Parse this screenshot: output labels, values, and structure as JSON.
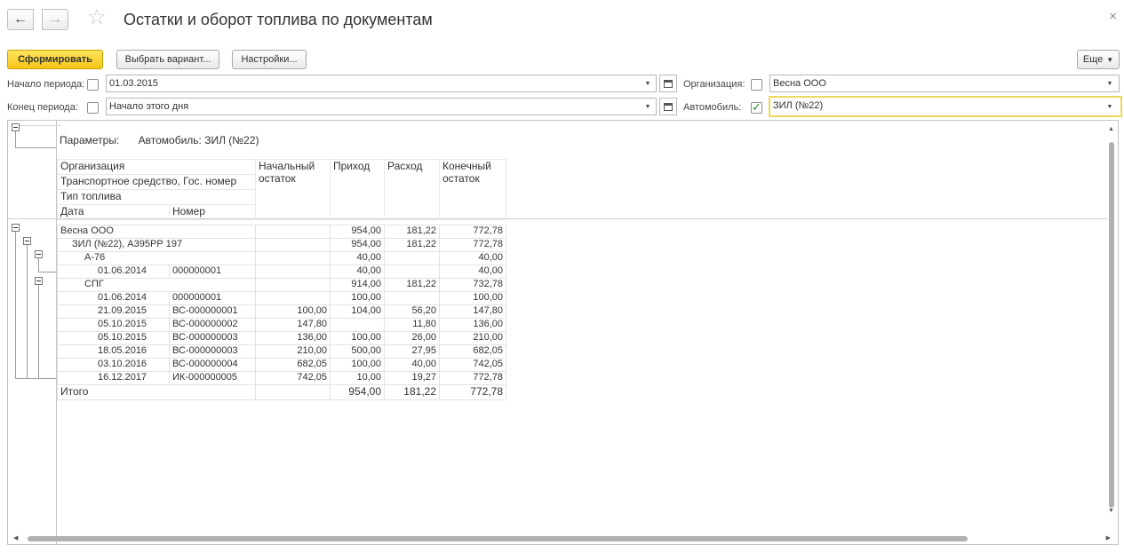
{
  "window": {
    "title": "Остатки и оборот топлива по документам",
    "back_icon": "←",
    "forward_icon": "→",
    "star_icon": "☆",
    "close_icon": "×"
  },
  "toolbar": {
    "generate_label": "Сформировать",
    "variant_label": "Выбрать вариант...",
    "settings_label": "Настройки...",
    "more_label": "Еще",
    "more_arrow": "▼"
  },
  "filters": {
    "period_start_label": "Начало периода:",
    "period_start_value": "01.03.2015",
    "period_end_label": "Конец периода:",
    "period_end_value": "Начало этого дня",
    "organization_label": "Организация:",
    "organization_value": "Весна ООО",
    "vehicle_label": "Автомобиль:",
    "vehicle_value": "ЗИЛ (№22)",
    "dropdown_arrow": "▼"
  },
  "report": {
    "params_label": "Параметры:",
    "params_value": "Автомобиль: ЗИЛ (№22)",
    "header": {
      "organization": "Организация",
      "vehicle": "Транспортное средство, Гос. номер",
      "fuel_type": "Тип топлива",
      "date": "Дата",
      "number": "Номер",
      "opening": "Начальный остаток",
      "income": "Приход",
      "expense": "Расход",
      "closing": "Конечный остаток"
    },
    "rows": [
      {
        "label": "Весна ООО",
        "number": "",
        "opening": "",
        "income": "954,00",
        "expense": "181,22",
        "closing": "772,78"
      },
      {
        "label": "ЗИЛ (№22), А395РР 197",
        "number": "",
        "opening": "",
        "income": "954,00",
        "expense": "181,22",
        "closing": "772,78"
      },
      {
        "label": "А-76",
        "number": "",
        "opening": "",
        "income": "40,00",
        "expense": "",
        "closing": "40,00"
      },
      {
        "label": "01.06.2014",
        "number": "000000001",
        "opening": "",
        "income": "40,00",
        "expense": "",
        "closing": "40,00"
      },
      {
        "label": "СПГ",
        "number": "",
        "opening": "",
        "income": "914,00",
        "expense": "181,22",
        "closing": "732,78"
      },
      {
        "label": "01.06.2014",
        "number": "000000001",
        "opening": "",
        "income": "100,00",
        "expense": "",
        "closing": "100,00"
      },
      {
        "label": "21.09.2015",
        "number": "ВС-000000001",
        "opening": "100,00",
        "income": "104,00",
        "expense": "56,20",
        "closing": "147,80"
      },
      {
        "label": "05.10.2015",
        "number": "ВС-000000002",
        "opening": "147,80",
        "income": "",
        "expense": "11,80",
        "closing": "136,00"
      },
      {
        "label": "05.10.2015",
        "number": "ВС-000000003",
        "opening": "136,00",
        "income": "100,00",
        "expense": "26,00",
        "closing": "210,00"
      },
      {
        "label": "18.05.2016",
        "number": "ВС-000000003",
        "opening": "210,00",
        "income": "500,00",
        "expense": "27,95",
        "closing": "682,05"
      },
      {
        "label": "03.10.2016",
        "number": "ВС-000000004",
        "opening": "682,05",
        "income": "100,00",
        "expense": "40,00",
        "closing": "742,05"
      },
      {
        "label": "16.12.2017",
        "number": "ИК-000000005",
        "opening": "742,05",
        "income": "10,00",
        "expense": "19,27",
        "closing": "772,78"
      }
    ],
    "total": {
      "label": "Итого",
      "income": "954,00",
      "expense": "181,22",
      "closing": "772,78"
    }
  }
}
